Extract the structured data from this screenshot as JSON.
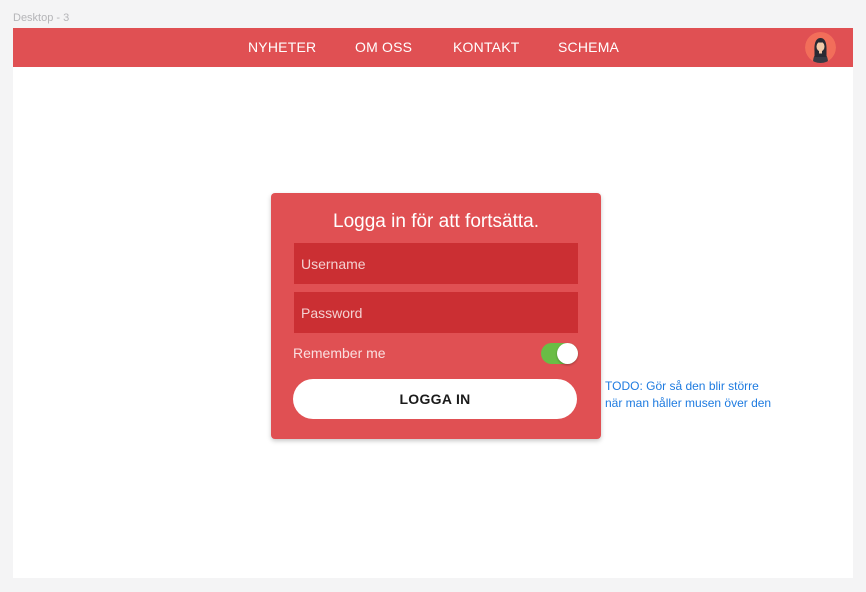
{
  "frame": {
    "label": "Desktop - 3"
  },
  "navbar": {
    "items": [
      {
        "label": "NYHETER"
      },
      {
        "label": "OM OSS"
      },
      {
        "label": "KONTAKT"
      },
      {
        "label": "SCHEMA"
      }
    ],
    "avatar_icon": "user-avatar-icon",
    "background_color": "#e05053"
  },
  "login": {
    "title": "Logga in för att fortsätta.",
    "username_placeholder": "Username",
    "password_placeholder": "Password",
    "remember_label": "Remember me",
    "remember_checked": true,
    "submit_label": "LOGGA IN",
    "card_color": "#e05053",
    "field_color": "#cb2f33",
    "toggle_on_color": "#6abd45"
  },
  "note": {
    "line1": "TODO: Gör så den blir större",
    "line2": "när man håller musen över den",
    "color": "#1e7be0"
  }
}
